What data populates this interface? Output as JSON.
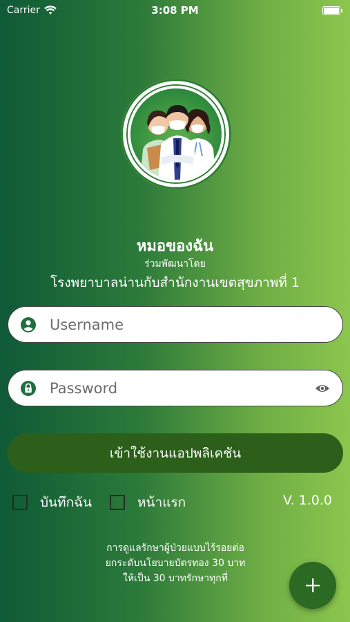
{
  "status_bar": {
    "carrier": "Carrier",
    "time": "3:08 PM"
  },
  "app": {
    "title": "หมอของฉัน",
    "subtitle": "ร่วมพัฒนาโดย",
    "organization": "โรงพยาบาลน่านกับสำนักงานเขตสุขภาพที่ 1"
  },
  "login": {
    "username_placeholder": "Username",
    "password_placeholder": "Password",
    "submit_label": "เข้าใช้งานแอปพลิเคชัน"
  },
  "options": {
    "remember_label": "บันทึกฉัน",
    "home_label": "หน้าแรก",
    "version": "V. 1.0.0"
  },
  "footer": {
    "line1": "การดูแลรักษาผู้ป่วยแบบไร้รอยต่อ",
    "line2": "ยกระดับนโยบายบัตรทอง 30 บาท",
    "line3": "ให้เป็น 30 บาทรักษาทุกที่"
  },
  "colors": {
    "primary_button": "#2b5f1a",
    "fab": "#2a6a22",
    "icon": "#1f6f3f"
  },
  "icons": {
    "wifi": "wifi-icon",
    "battery": "battery-icon",
    "user": "user-circle-icon",
    "lock": "lock-icon",
    "visibility": "eye-icon",
    "add": "plus-icon"
  }
}
